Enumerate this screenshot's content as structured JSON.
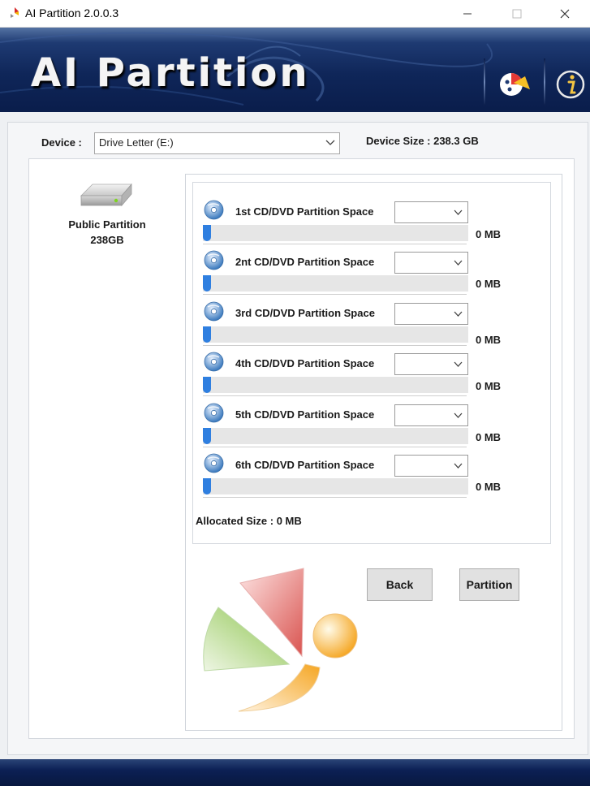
{
  "window": {
    "title": "AI Partition 2.0.0.3",
    "minimize_symbol": "—",
    "maximize_symbol": "☐",
    "close_symbol": "✕"
  },
  "header": {
    "title": "AI Partition",
    "icons": [
      "partition-pie-icon",
      "info-icon"
    ]
  },
  "device": {
    "label": "Device :",
    "selected": "Drive Letter (E:)",
    "size_text": "Device Size : 238.3 GB"
  },
  "drive": {
    "icon": "hard-drive-icon",
    "name": "Public Partition",
    "size": "238GB"
  },
  "partitions": [
    {
      "label": "1st CD/DVD Partition Space",
      "size": "0 MB",
      "selected": "",
      "level": 0
    },
    {
      "label": "2nt CD/DVD Partition Space",
      "size": "0 MB",
      "selected": "",
      "level": 0
    },
    {
      "label": "3rd CD/DVD Partition Space",
      "size": "0 MB",
      "selected": "",
      "level": 0
    },
    {
      "label": "4th CD/DVD Partition Space",
      "size": "0 MB",
      "selected": "",
      "level": 0
    },
    {
      "label": "5th CD/DVD Partition Space",
      "size": "0 MB",
      "selected": "",
      "level": 0
    },
    {
      "label": "6th CD/DVD Partition Space",
      "size": "0 MB",
      "selected": "",
      "level": 0
    }
  ],
  "allocated": "Allocated Size : 0 MB",
  "buttons": {
    "back": "Back",
    "partition": "Partition"
  },
  "colors": {
    "banner": "#0f2659",
    "slider_thumb": "#2f7fe0",
    "pie_red": "#d9534f",
    "pie_green": "#8bc34a",
    "pie_orange": "#f5a623"
  }
}
